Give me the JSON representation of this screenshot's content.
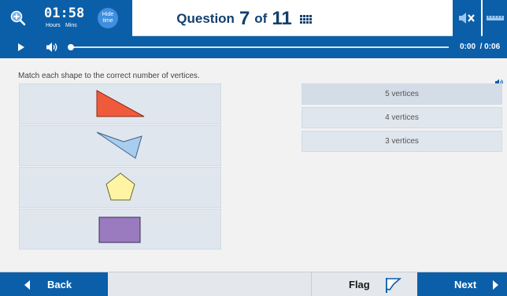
{
  "header": {
    "timer": {
      "hours": "01",
      "minutes": "58",
      "separator": ":",
      "hours_label": "Hours",
      "minutes_label": "Mins"
    },
    "hide_time_label": "Hide time",
    "question": {
      "prefix": "Question",
      "current": "7",
      "of_word": "of",
      "total": "11"
    },
    "icons": {
      "zoom": "zoom-in-icon",
      "question_grid": "question-grid-icon",
      "mute": "speaker-mute-icon",
      "ruler": "ruler-icon"
    }
  },
  "media": {
    "current_time": "0:00",
    "duration": "/ 0:06",
    "progress": 0,
    "icons": {
      "play": "play-icon",
      "volume": "speaker-icon"
    }
  },
  "question_body": {
    "instruction": "Match each shape to the correct number of vertices.",
    "shapes": [
      {
        "shape": "triangle",
        "color": "#f05a3c"
      },
      {
        "shape": "quadrilateral-arrowhead",
        "color": "#a9cdee"
      },
      {
        "shape": "pentagon",
        "color": "#fff4a3"
      },
      {
        "shape": "rectangle",
        "color": "#9a7bc0"
      }
    ],
    "answers": [
      "5 vertices",
      "4 vertices",
      "3 vertices"
    ]
  },
  "footer": {
    "back_label": "Back",
    "flag_label": "Flag",
    "next_label": "Next"
  },
  "colors": {
    "brand_blue": "#0b5fa8",
    "title_navy": "#12406f",
    "tile_bg": "#dfe6ee"
  }
}
